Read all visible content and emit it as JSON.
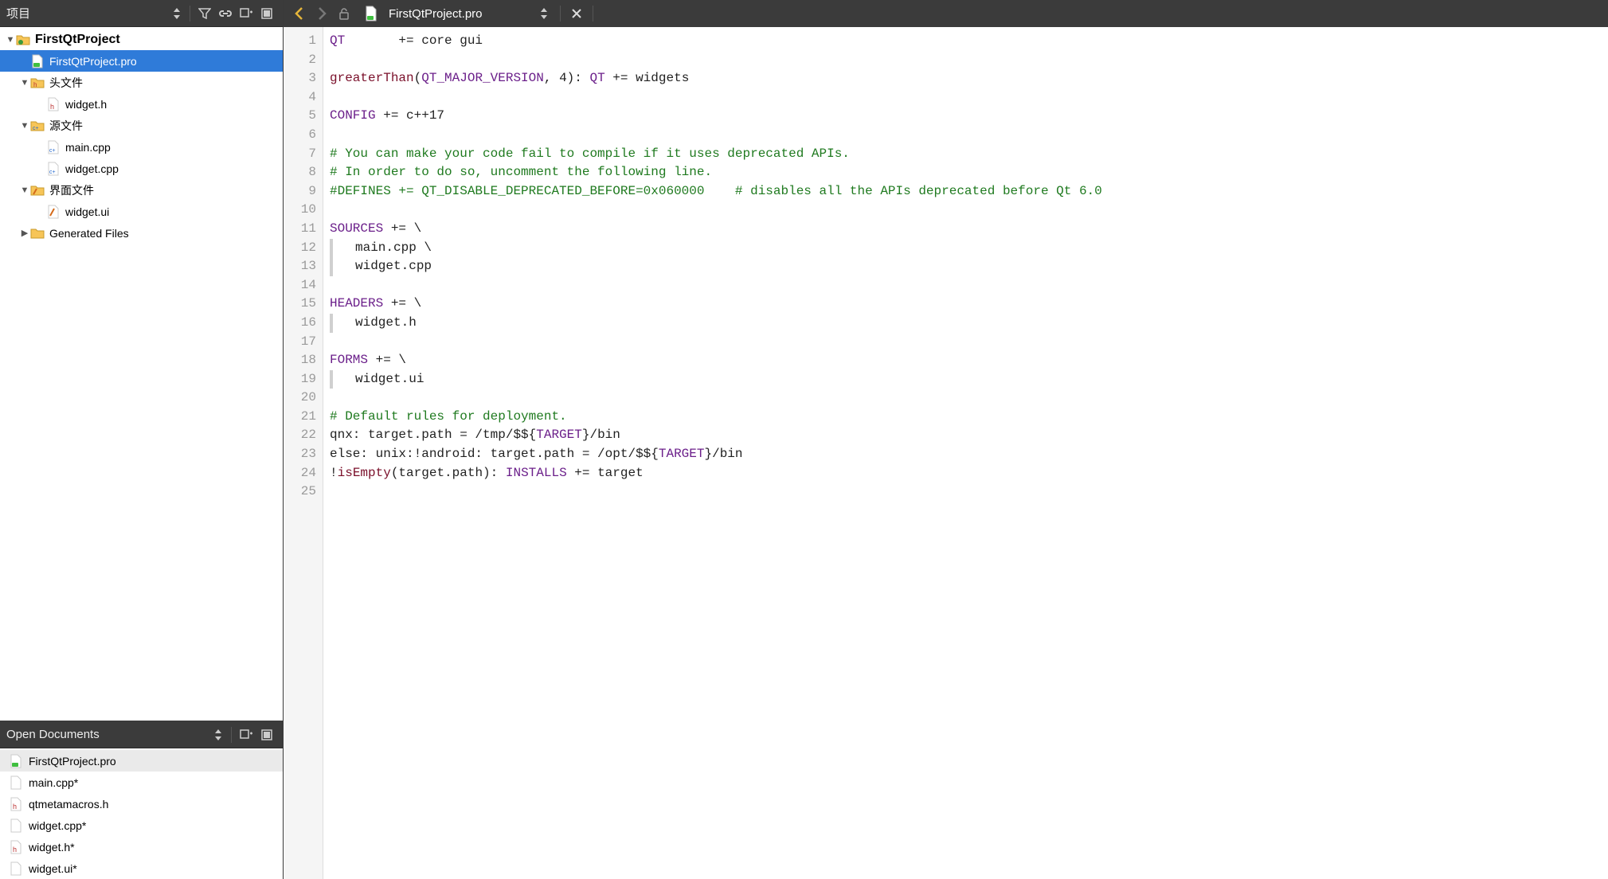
{
  "project_panel": {
    "title": "项目",
    "tree": {
      "root": {
        "label": "FirstQtProject",
        "expanded": true
      },
      "pro": {
        "label": "FirstQtProject.pro",
        "selected": true
      },
      "headers_folder": {
        "label": "头文件",
        "expanded": true
      },
      "header_file": {
        "label": "widget.h"
      },
      "sources_folder": {
        "label": "源文件",
        "expanded": true
      },
      "source_main": {
        "label": "main.cpp"
      },
      "source_widget": {
        "label": "widget.cpp"
      },
      "forms_folder": {
        "label": "界面文件",
        "expanded": true
      },
      "form_widget": {
        "label": "widget.ui"
      },
      "generated": {
        "label": "Generated Files",
        "expanded": false
      }
    }
  },
  "open_docs": {
    "title": "Open Documents",
    "items": [
      {
        "label": "FirstQtProject.pro",
        "active": true
      },
      {
        "label": "main.cpp*"
      },
      {
        "label": "qtmetamacros.h"
      },
      {
        "label": "widget.cpp*"
      },
      {
        "label": "widget.h*"
      },
      {
        "label": "widget.ui*"
      }
    ]
  },
  "editor_tab": {
    "title": "FirstQtProject.pro"
  },
  "code_lines": [
    {
      "n": 1,
      "segments": [
        {
          "cls": "kw",
          "t": "QT"
        },
        {
          "cls": "plain",
          "t": "       += core gui"
        }
      ]
    },
    {
      "n": 2,
      "segments": []
    },
    {
      "n": 3,
      "segments": [
        {
          "cls": "fn",
          "t": "greaterThan"
        },
        {
          "cls": "plain",
          "t": "("
        },
        {
          "cls": "kw",
          "t": "QT_MAJOR_VERSION"
        },
        {
          "cls": "plain",
          "t": ", 4): "
        },
        {
          "cls": "kw",
          "t": "QT"
        },
        {
          "cls": "plain",
          "t": " += widgets"
        }
      ]
    },
    {
      "n": 4,
      "segments": []
    },
    {
      "n": 5,
      "segments": [
        {
          "cls": "kw",
          "t": "CONFIG"
        },
        {
          "cls": "plain",
          "t": " += c++17"
        }
      ]
    },
    {
      "n": 6,
      "segments": []
    },
    {
      "n": 7,
      "segments": [
        {
          "cls": "cmt",
          "t": "# You can make your code fail to compile if it uses deprecated APIs."
        }
      ]
    },
    {
      "n": 8,
      "segments": [
        {
          "cls": "cmt",
          "t": "# In order to do so, uncomment the following line."
        }
      ]
    },
    {
      "n": 9,
      "segments": [
        {
          "cls": "cmt",
          "t": "#DEFINES += QT_DISABLE_DEPRECATED_BEFORE=0x060000    # disables all the APIs deprecated before Qt 6.0"
        }
      ]
    },
    {
      "n": 10,
      "segments": []
    },
    {
      "n": 11,
      "segments": [
        {
          "cls": "kw",
          "t": "SOURCES"
        },
        {
          "cls": "plain",
          "t": " += \\"
        }
      ]
    },
    {
      "n": 12,
      "cont": true,
      "segments": [
        {
          "cls": "plain",
          "t": "main.cpp \\"
        }
      ]
    },
    {
      "n": 13,
      "cont": true,
      "segments": [
        {
          "cls": "plain",
          "t": "widget.cpp"
        }
      ]
    },
    {
      "n": 14,
      "segments": []
    },
    {
      "n": 15,
      "segments": [
        {
          "cls": "kw",
          "t": "HEADERS"
        },
        {
          "cls": "plain",
          "t": " += \\"
        }
      ]
    },
    {
      "n": 16,
      "cont": true,
      "segments": [
        {
          "cls": "plain",
          "t": "widget.h"
        }
      ]
    },
    {
      "n": 17,
      "segments": []
    },
    {
      "n": 18,
      "segments": [
        {
          "cls": "kw",
          "t": "FORMS"
        },
        {
          "cls": "plain",
          "t": " += \\"
        }
      ]
    },
    {
      "n": 19,
      "cont": true,
      "segments": [
        {
          "cls": "plain",
          "t": "widget.ui"
        }
      ]
    },
    {
      "n": 20,
      "segments": []
    },
    {
      "n": 21,
      "segments": [
        {
          "cls": "cmt",
          "t": "# Default rules for deployment."
        }
      ]
    },
    {
      "n": 22,
      "segments": [
        {
          "cls": "plain",
          "t": "qnx: target.path = /tmp/$${"
        },
        {
          "cls": "kw",
          "t": "TARGET"
        },
        {
          "cls": "plain",
          "t": "}/bin"
        }
      ]
    },
    {
      "n": 23,
      "segments": [
        {
          "cls": "plain",
          "t": "else: unix:!android: target.path = /opt/$${"
        },
        {
          "cls": "kw",
          "t": "TARGET"
        },
        {
          "cls": "plain",
          "t": "}/bin"
        }
      ]
    },
    {
      "n": 24,
      "segments": [
        {
          "cls": "plain",
          "t": "!"
        },
        {
          "cls": "fn",
          "t": "isEmpty"
        },
        {
          "cls": "plain",
          "t": "(target.path): "
        },
        {
          "cls": "kw",
          "t": "INSTALLS"
        },
        {
          "cls": "plain",
          "t": " += target"
        }
      ]
    },
    {
      "n": 25,
      "segments": []
    }
  ]
}
